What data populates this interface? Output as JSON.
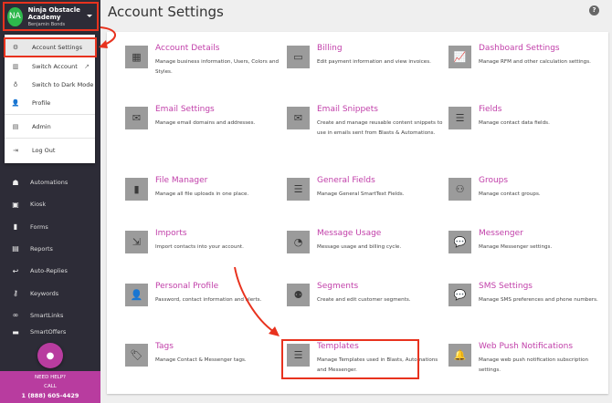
{
  "page": {
    "title": "Account Settings",
    "help_icon": "question-circle-icon"
  },
  "account": {
    "initials": "NA",
    "org": "Ninja Obstacle Academy",
    "user": "Benjamin Bonds",
    "avatar_color": "#2eb84c"
  },
  "menu": {
    "items": [
      {
        "label": "Account Settings",
        "icon": "gear-icon",
        "glyph": "⚙"
      },
      {
        "label": "Switch Account",
        "icon": "building-icon",
        "glyph": "▥",
        "ext": "↗"
      },
      {
        "label": "Switch to Dark Mode",
        "icon": "lightbulb-icon",
        "glyph": "♁"
      },
      {
        "label": "Profile",
        "icon": "user-cog-icon",
        "glyph": "👤"
      },
      {
        "label": "Admin",
        "icon": "admin-icon",
        "glyph": "▤"
      },
      {
        "label": "Log Out",
        "icon": "sign-out-icon",
        "glyph": "⇥"
      }
    ]
  },
  "sidebar": {
    "items": [
      {
        "label": "Automations",
        "icon": "robot-icon",
        "glyph": "☗"
      },
      {
        "label": "Kiosk",
        "icon": "kiosk-icon",
        "glyph": "▣"
      },
      {
        "label": "Forms",
        "icon": "file-icon",
        "glyph": "▮"
      },
      {
        "label": "Reports",
        "icon": "report-icon",
        "glyph": "▤"
      },
      {
        "label": "Auto-Replies",
        "icon": "reply-icon",
        "glyph": "↩"
      },
      {
        "label": "Keywords",
        "icon": "key-icon",
        "glyph": "⚷"
      },
      {
        "label": "SmartLinks",
        "icon": "link-icon",
        "glyph": "∞"
      },
      {
        "label": "SmartOffers",
        "icon": "offer-icon",
        "glyph": "▬"
      }
    ],
    "chat_icon": "chat-bubble-icon",
    "help": {
      "line1": "NEED HELP?",
      "line2": "CALL",
      "phone": "1 (888) 605-4429"
    }
  },
  "accent": "#c13fa9",
  "tiles": [
    {
      "title": "Account Details",
      "desc": "Manage business information, Users, Colors and Styles.",
      "icon": "building-icon",
      "glyph": "▦"
    },
    {
      "title": "Billing",
      "desc": "Edit payment information and view invoices.",
      "icon": "credit-card-icon",
      "glyph": "▭"
    },
    {
      "title": "Dashboard Settings",
      "desc": "Manage RFM and other calculation settings.",
      "icon": "chart-line-icon",
      "glyph": "📈"
    },
    {
      "title": "Email Settings",
      "desc": "Manage email domains and addresses.",
      "icon": "envelope-icon",
      "glyph": "✉"
    },
    {
      "title": "Email Snippets",
      "desc": "Create and manage reusable content snippets to use in emails sent from Blasts & Automations.",
      "icon": "envelope-icon",
      "glyph": "✉"
    },
    {
      "title": "Fields",
      "desc": "Manage contact data fields.",
      "icon": "database-icon",
      "glyph": "☰"
    },
    {
      "title": "File Manager",
      "desc": "Manage all file uploads in one place.",
      "icon": "file-icon",
      "glyph": "▮"
    },
    {
      "title": "General Fields",
      "desc": "Manage General SmartText Fields.",
      "icon": "database-icon",
      "glyph": "☰"
    },
    {
      "title": "Groups",
      "desc": "Manage contact groups.",
      "icon": "users-icon",
      "glyph": "⚇"
    },
    {
      "title": "Imports",
      "desc": "Import contacts into your account.",
      "icon": "import-icon",
      "glyph": "⇲"
    },
    {
      "title": "Message Usage",
      "desc": "Message usage and billing cycle.",
      "icon": "pie-chart-icon",
      "glyph": "◔"
    },
    {
      "title": "Messenger",
      "desc": "Manage Messenger settings.",
      "icon": "comments-icon",
      "glyph": "💬"
    },
    {
      "title": "Personal Profile",
      "desc": "Password, contact information and alerts.",
      "icon": "user-icon",
      "glyph": "👤"
    },
    {
      "title": "Segments",
      "desc": "Create and edit customer segments.",
      "icon": "people-group-icon",
      "glyph": "⚉"
    },
    {
      "title": "SMS Settings",
      "desc": "Manage SMS preferences and phone numbers.",
      "icon": "sms-icon",
      "glyph": "💬"
    },
    {
      "title": "Tags",
      "desc": "Manage Contact & Messenger tags.",
      "icon": "tags-icon",
      "glyph": "🏷"
    },
    {
      "title": "Templates",
      "desc": "Manage Templates used in Blasts, Automations and Messenger.",
      "icon": "database-icon",
      "glyph": "☰"
    },
    {
      "title": "Web Push Notifications",
      "desc": "Manage web push notification subscription settings.",
      "icon": "bell-icon",
      "glyph": "🔔"
    }
  ]
}
